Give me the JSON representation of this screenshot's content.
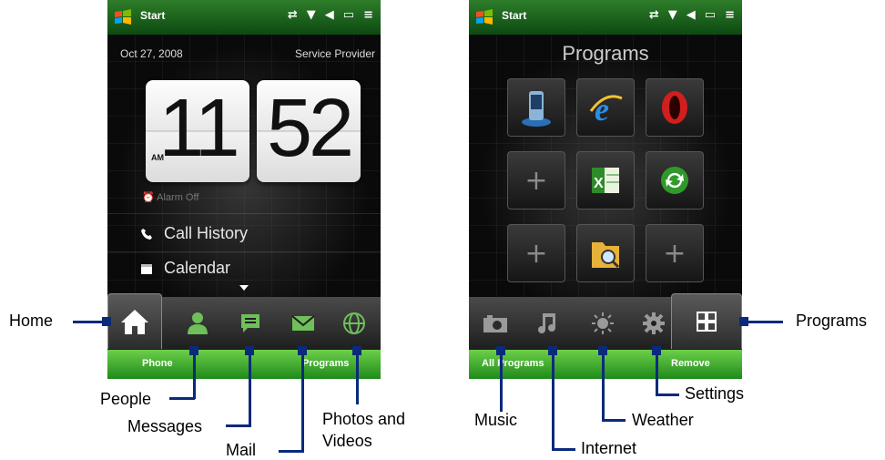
{
  "screen1": {
    "titlebar": {
      "start": "Start"
    },
    "home": {
      "date": "Oct 27, 2008",
      "provider": "Service Provider",
      "clock": {
        "hour": "11",
        "minute": "52",
        "ampm": "AM"
      },
      "alarm": "Alarm Off",
      "rows": [
        {
          "label": "Call History",
          "icon": "phone-icon"
        },
        {
          "label": "Calendar",
          "icon": "calendar-icon"
        }
      ]
    },
    "tabs": [
      "home-icon",
      "people-icon",
      "messages-icon",
      "mail-icon",
      "globe-icon"
    ],
    "softkeys": {
      "left": "Phone",
      "right": "Programs"
    }
  },
  "screen2": {
    "titlebar": {
      "start": "Start"
    },
    "programs_title": "Programs",
    "grid": [
      [
        "phone-app-icon",
        "internet-explorer-icon",
        "opera-icon"
      ],
      [
        "plus-icon",
        "excel-icon",
        "sync-icon"
      ],
      [
        "plus-icon",
        "file-search-icon",
        "plus-icon"
      ]
    ],
    "tabs": [
      "camera-icon",
      "music-icon",
      "sun-icon",
      "settings-icon",
      "programs-grid-icon"
    ],
    "softkeys": {
      "left": "All Programs",
      "right": "Remove"
    }
  },
  "callouts": {
    "home": "Home",
    "people": "People",
    "messages": "Messages",
    "mail": "Mail",
    "photos": "Photos and\nVideos",
    "music": "Music",
    "internet": "Internet",
    "weather": "Weather",
    "settings": "Settings",
    "programs": "Programs"
  },
  "colors": {
    "titlebar": "#1e6b21",
    "softbar": "#3fae2e",
    "callout_line": "#0a2a7a"
  }
}
